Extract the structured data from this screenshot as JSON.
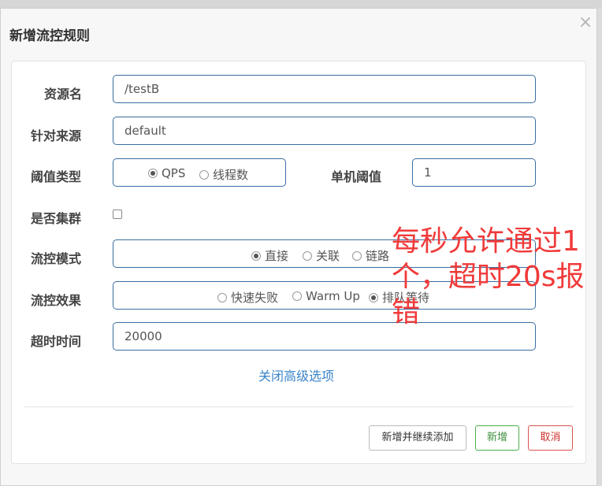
{
  "dialog": {
    "title": "新增流控规则",
    "close_symbol": "×"
  },
  "form": {
    "resource_name": {
      "label": "资源名",
      "value": "/testB"
    },
    "limit_app": {
      "label": "针对来源",
      "value": "default"
    },
    "threshold_type": {
      "label": "阈值类型",
      "options": [
        "QPS",
        "线程数"
      ],
      "selected": "QPS"
    },
    "single_threshold": {
      "label": "单机阈值",
      "value": "1"
    },
    "cluster_mode": {
      "label": "是否集群",
      "checked": false
    },
    "flow_mode": {
      "label": "流控模式",
      "options": [
        "直接",
        "关联",
        "链路"
      ],
      "selected": "直接"
    },
    "flow_effect": {
      "label": "流控效果",
      "options": [
        "快速失败",
        "Warm Up",
        "排队等待"
      ],
      "selected": "排队等待"
    },
    "timeout": {
      "label": "超时时间",
      "value": "20000"
    },
    "advanced_toggle": "关闭高级选项"
  },
  "footer": {
    "add_and_continue": "新增并继续添加",
    "add": "新增",
    "cancel": "取消"
  },
  "annotation": {
    "text": "每秒允许通过1个，超时20s报错",
    "color": "#f03a3a"
  }
}
